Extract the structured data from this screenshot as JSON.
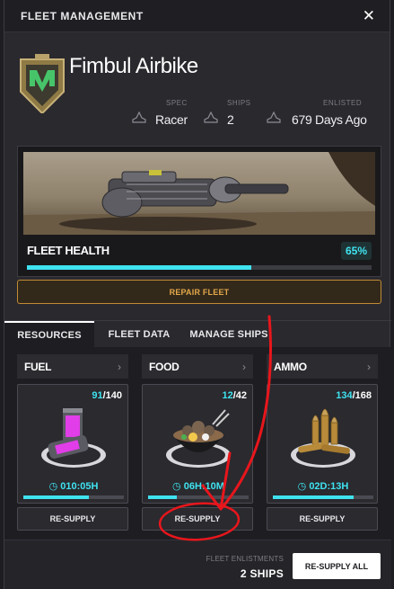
{
  "header": {
    "title": "FLEET MANAGEMENT",
    "close_icon": "close-icon"
  },
  "fleet": {
    "name": "Fimbul Airbike",
    "crest_icon": "fleet-crest-icon",
    "stats": [
      {
        "label": "SPEC",
        "value": "Racer",
        "icon": "ship-icon"
      },
      {
        "label": "SHIPS",
        "value": "2",
        "icon": "ship-icon"
      },
      {
        "label": "ENLISTED",
        "value": "679 Days Ago",
        "icon": "ship-icon"
      }
    ]
  },
  "health": {
    "label": "FLEET HEALTH",
    "percent_text": "65%",
    "percent": 65
  },
  "repair_button": "REPAIR FLEET",
  "tabs": [
    {
      "label": "RESOURCES",
      "active": true
    },
    {
      "label": "FLEET DATA",
      "active": false
    },
    {
      "label": "MANAGE SHIPS",
      "active": false
    }
  ],
  "resources": [
    {
      "name": "FUEL",
      "current": "91",
      "max": "/140",
      "timer": "010:05H",
      "fill": 0.65,
      "button": "RE-SUPPLY",
      "icon": "fuel-canister-icon"
    },
    {
      "name": "FOOD",
      "current": "12",
      "max": "/42",
      "timer": "06H:10M",
      "fill": 0.29,
      "button": "RE-SUPPLY",
      "icon": "food-bowl-icon"
    },
    {
      "name": "AMMO",
      "current": "134",
      "max": "/168",
      "timer": "02D:13H",
      "fill": 0.8,
      "button": "RE-SUPPLY",
      "icon": "ammo-bullets-icon"
    }
  ],
  "footer": {
    "label": "FLEET ENLISTMENTS",
    "value": "2 SHIPS",
    "resupply_all": "RE-SUPPLY ALL"
  },
  "colors": {
    "accent": "#3fe3f0",
    "repair": "#e3a84a",
    "annotation": "#e8161c"
  }
}
